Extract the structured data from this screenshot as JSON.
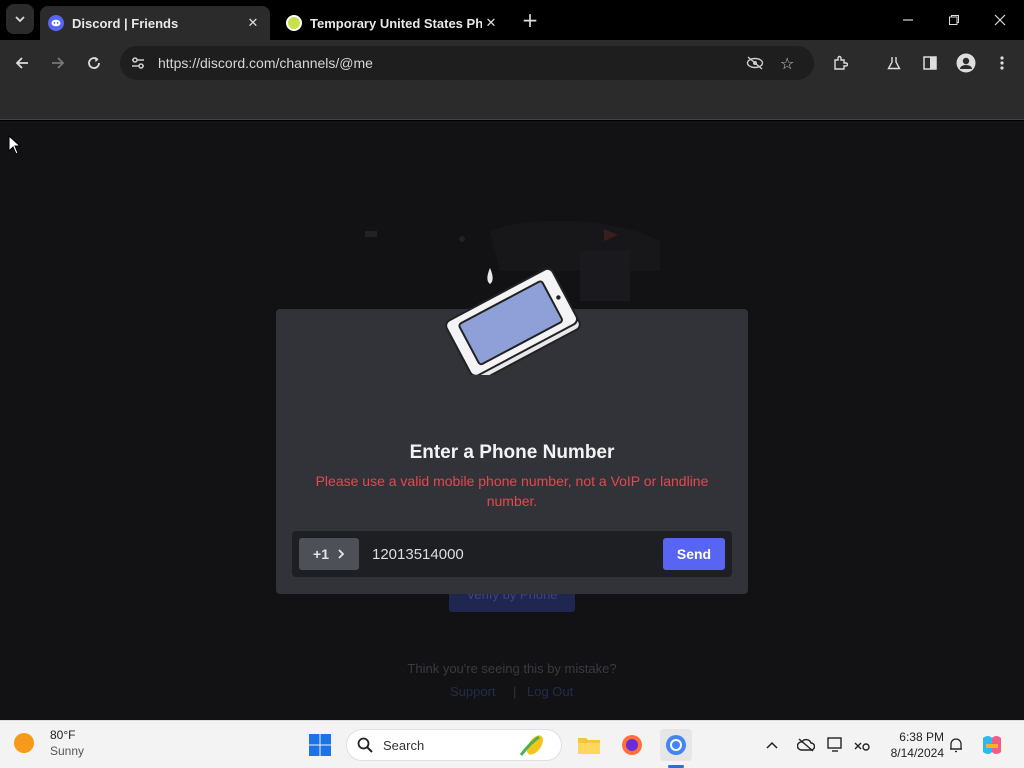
{
  "browser": {
    "tabs": [
      {
        "title": "Discord | Friends",
        "active": true
      },
      {
        "title": "Temporary United States Phon",
        "active": false
      }
    ],
    "address": "https://discord.com/channels/@me"
  },
  "background": {
    "faded_button": "Verify by Phone",
    "mistake_text": "Think you're seeing this by mistake?",
    "support_link": "Support",
    "logout_link": "Log Out"
  },
  "modal": {
    "title": "Enter a Phone Number",
    "error": "Please use a valid mobile phone number, not a VoIP or landline number.",
    "country_code": "+1",
    "phone_value": "12013514000",
    "send_label": "Send"
  },
  "taskbar": {
    "weather_temp": "80°F",
    "weather_desc": "Sunny",
    "search_placeholder": "Search",
    "time": "6:38 PM",
    "date": "8/14/2024"
  },
  "colors": {
    "accent": "#5865f2",
    "error": "#e5484d",
    "modal_bg": "#313338"
  }
}
